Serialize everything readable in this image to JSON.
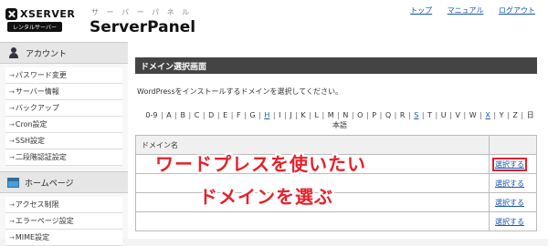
{
  "brand": {
    "logo_text": "XSERVER",
    "logo_subtitle": "レンタルサーバー",
    "product_kana": "サ ー バ ー パ ネ ル",
    "product_name": "ServerPanel"
  },
  "topnav": [
    "トップ",
    "マニュアル",
    "ログアウト"
  ],
  "sidebar": {
    "sections": [
      {
        "title": "アカウント",
        "icon": "person-icon",
        "items": [
          "パスワード変更",
          "サーバー情報",
          "バックアップ",
          "Cron設定",
          "SSH設定",
          "二段階認証設定"
        ]
      },
      {
        "title": "ホームページ",
        "icon": "webpage-icon",
        "items": [
          "アクセス制限",
          "エラーページ設定",
          "MIME設定"
        ]
      }
    ]
  },
  "main": {
    "panel_title": "ドメイン選択画面",
    "description": "WordPressをインストールするドメインを選択してください。",
    "alphabet": [
      "0-9",
      "A",
      "B",
      "C",
      "D",
      "E",
      "F",
      "G",
      "H",
      "I",
      "J",
      "K",
      "L",
      "M",
      "N",
      "O",
      "P",
      "Q",
      "R",
      "S",
      "T",
      "U",
      "V",
      "W",
      "X",
      "Y",
      "Z",
      "日本語"
    ],
    "alphabet_linked": [
      "X",
      "H",
      "S"
    ],
    "table_header": "ドメイン名",
    "rows": [
      {
        "domain": "",
        "action": "選択する"
      },
      {
        "domain": "",
        "action": "選択する"
      },
      {
        "domain": "",
        "action": "選択する"
      },
      {
        "domain": "",
        "action": "選択する"
      }
    ]
  },
  "overlay": {
    "line1": "ワードプレスを使いたい",
    "line2": "ドメインを選ぶ",
    "color": "#e8202a"
  }
}
